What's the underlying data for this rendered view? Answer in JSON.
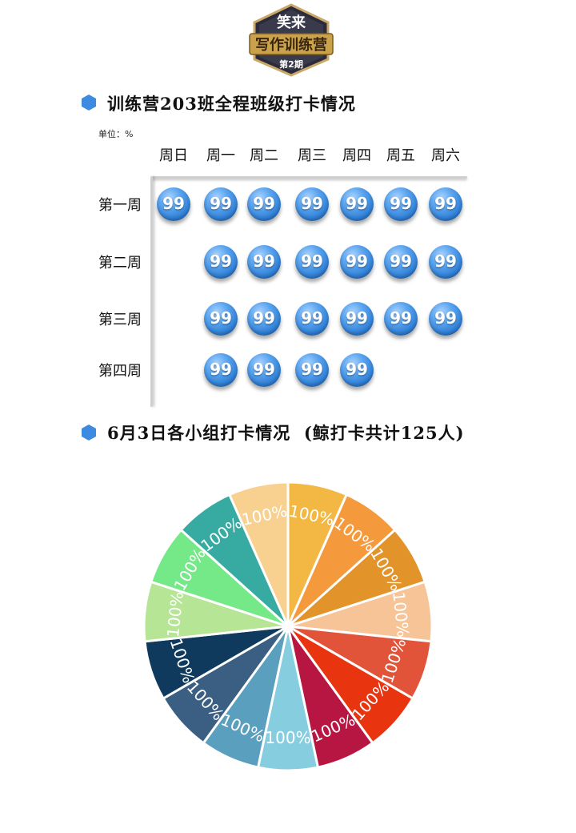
{
  "logo": {
    "top_text": "笑来",
    "main_text": "写作训练营",
    "edition": "第2期"
  },
  "section1": {
    "title": "训练营203班全程班级打卡情况",
    "unit": "单位：%"
  },
  "section2": {
    "title": "6月3日各小组打卡情况",
    "note": "(鲸打卡共计125人)"
  },
  "colors": {
    "bullet": "#3d8be0",
    "bubble": "#3a8ae0",
    "frame": "#cfcfcf"
  },
  "chart_data": [
    {
      "type": "table",
      "title": "训练营203班全程班级打卡情况",
      "unit": "单位：%",
      "columns": [
        "周日",
        "周一",
        "周二",
        "周三",
        "周四",
        "周五",
        "周六"
      ],
      "rows": [
        {
          "label": "第一周",
          "values": [
            99,
            99,
            99,
            99,
            99,
            99,
            99
          ]
        },
        {
          "label": "第二周",
          "values": [
            null,
            99,
            99,
            99,
            99,
            99,
            99
          ]
        },
        {
          "label": "第三周",
          "values": [
            null,
            99,
            99,
            99,
            99,
            99,
            99
          ]
        },
        {
          "label": "第四周",
          "values": [
            null,
            99,
            99,
            99,
            99,
            null,
            null
          ]
        }
      ]
    },
    {
      "type": "pie",
      "title": "6月3日各小组打卡情况",
      "subtitle": "(鲸打卡共计125人)",
      "slices": [
        {
          "value": 1,
          "label": "100%",
          "color": "#f2b843"
        },
        {
          "value": 1,
          "label": "100%",
          "color": "#f59a3c"
        },
        {
          "value": 1,
          "label": "100%",
          "color": "#e2932a"
        },
        {
          "value": 1,
          "label": "100%",
          "color": "#f7c497"
        },
        {
          "value": 1,
          "label": "100%",
          "color": "#e1543a"
        },
        {
          "value": 1,
          "label": "100%",
          "color": "#e8340f"
        },
        {
          "value": 1,
          "label": "100%",
          "color": "#b71643"
        },
        {
          "value": 1,
          "label": "100%",
          "color": "#87cde0"
        },
        {
          "value": 1,
          "label": "100%",
          "color": "#5a9fbd"
        },
        {
          "value": 1,
          "label": "100%",
          "color": "#3a5f82"
        },
        {
          "value": 1,
          "label": "100%",
          "color": "#0f3a5e"
        },
        {
          "value": 1,
          "label": "100%",
          "color": "#b6e596"
        },
        {
          "value": 1,
          "label": "100%",
          "color": "#75e888"
        },
        {
          "value": 1,
          "label": "100%",
          "color": "#37aba2"
        },
        {
          "value": 1,
          "label": "100%",
          "color": "#f8d190"
        }
      ]
    }
  ]
}
